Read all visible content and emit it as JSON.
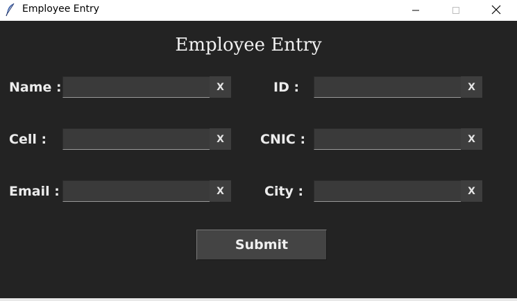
{
  "window": {
    "title": "Employee Entry"
  },
  "form": {
    "heading": "Employee Entry",
    "clear_label": "X",
    "submit_label": "Submit",
    "fields": {
      "name": {
        "label": "Name :",
        "value": ""
      },
      "id": {
        "label": "ID :",
        "value": ""
      },
      "cell": {
        "label": "Cell :",
        "value": ""
      },
      "cnic": {
        "label": "CNIC :",
        "value": ""
      },
      "email": {
        "label": "Email :",
        "value": ""
      },
      "city": {
        "label": "City :",
        "value": ""
      }
    }
  },
  "colors": {
    "background": "#232323",
    "entry": "#3a3a3a",
    "button": "#444444",
    "text": "#ececec"
  },
  "icons": {
    "app": "feather-icon",
    "minimize": "minimize-icon",
    "maximize": "maximize-icon",
    "close": "close-icon"
  }
}
